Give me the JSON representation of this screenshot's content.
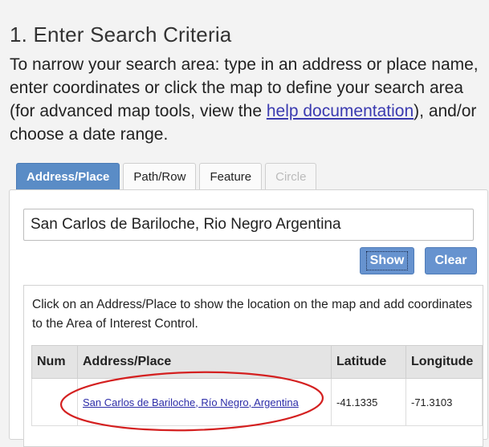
{
  "heading": "1. Enter Search Criteria",
  "intro": {
    "text_before": "To narrow your search area: type in an address or place name, enter coordinates or click the map to define your search area (for advanced map tools, view the ",
    "link": "help documentation",
    "text_after": "), and/or choose a date range."
  },
  "tabs": [
    {
      "label": "Address/Place",
      "state": "active"
    },
    {
      "label": "Path/Row",
      "state": "normal"
    },
    {
      "label": "Feature",
      "state": "normal"
    },
    {
      "label": "Circle",
      "state": "disabled"
    }
  ],
  "search": {
    "value": "San Carlos de Bariloche, Rio Negro Argentina"
  },
  "buttons": {
    "show": "Show",
    "clear": "Clear"
  },
  "results": {
    "info": "Click on an Address/Place to show the location on the map and add coordinates to the Area of Interest Control.",
    "columns": [
      "Num",
      "Address/Place",
      "Latitude",
      "Longitude"
    ],
    "rows": [
      {
        "num": "",
        "place": "San Carlos de Bariloche, Río Negro, Argentina",
        "latitude": "-41.1335",
        "longitude": "-71.3103"
      }
    ]
  },
  "colors": {
    "accent": "#5a8cc6",
    "annotation": "#d42020"
  }
}
